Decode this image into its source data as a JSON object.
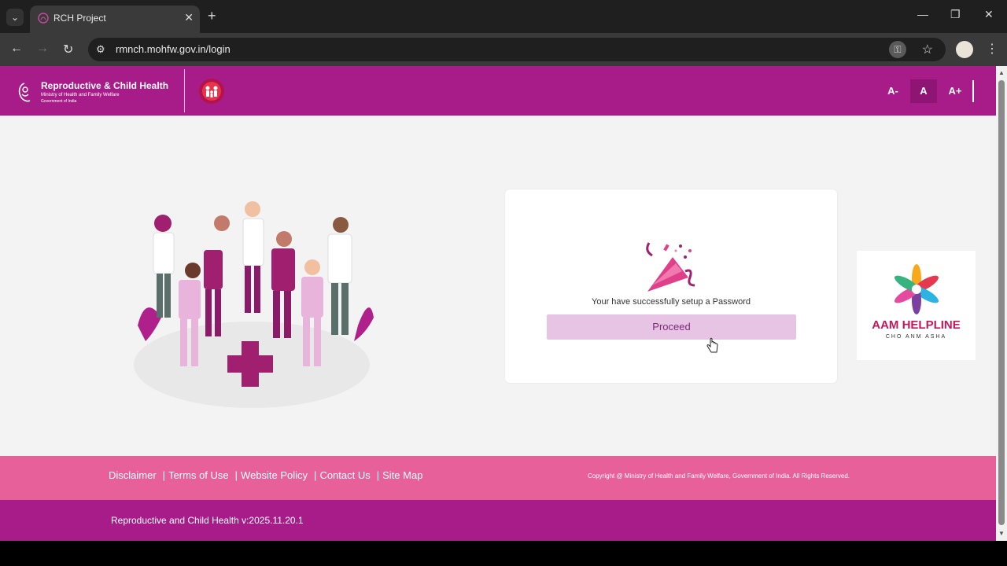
{
  "browser": {
    "tab_title": "RCH Project",
    "url": "rmnch.mohfw.gov.in/login",
    "icons": [
      "tab-menu-icon",
      "close-icon",
      "plus-icon",
      "minimize-icon",
      "restore-icon",
      "close-window-icon",
      "back-icon",
      "forward-icon",
      "reload-icon",
      "site-settings-icon",
      "password-key-icon",
      "star-icon",
      "profile-avatar",
      "kebab-menu-icon"
    ]
  },
  "header": {
    "title": "Reproductive & Child Health",
    "subtitle1": "Ministry of Health and Family Welfare",
    "subtitle2": "Government of India",
    "font_decrease": "A-",
    "font_normal": "A",
    "font_increase": "A+"
  },
  "card": {
    "message": "Your have successfully setup a Password",
    "proceed_label": "Proceed"
  },
  "aam": {
    "title": "AAM HELPLINE",
    "subtitle": "CHO ANM ASHA"
  },
  "footer": {
    "links": [
      "Disclaimer",
      "Terms of Use",
      "Website Policy",
      "Contact Us",
      "Site Map"
    ],
    "copyright": "Copyright @ Ministry of Health and Family Welfare, Government of India. All Rights Reserved.",
    "version": "Reproductive and Child Health v:2025.11.20.1"
  },
  "colors": {
    "header_purple": "#a81c89",
    "footer_pink": "#e8609a",
    "button_bg": "#e7c4e4"
  }
}
